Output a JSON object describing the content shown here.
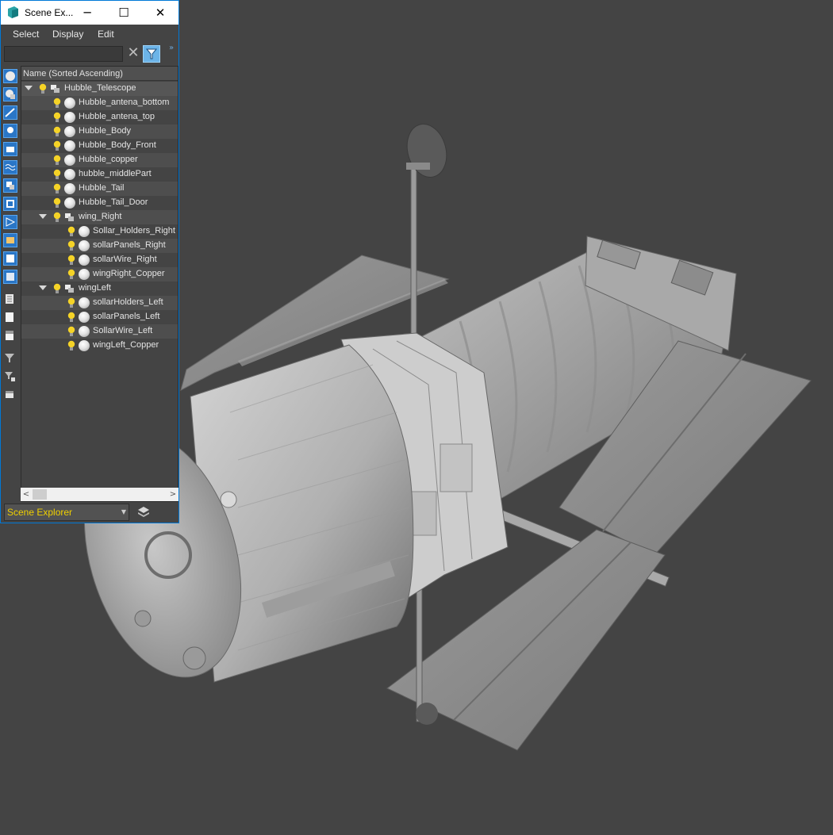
{
  "window": {
    "title": "Scene Ex...",
    "minimize_icon": "minimize-icon",
    "maximize_icon": "maximize-icon",
    "close_icon": "close-icon"
  },
  "menu": [
    "Select",
    "Display",
    "Edit"
  ],
  "search": {
    "value": "",
    "placeholder": ""
  },
  "toolbar_more": "»",
  "tree": {
    "header": "Name (Sorted Ascending)",
    "rows": [
      {
        "label": "Hubble_Telescope",
        "type": "group",
        "depth": 0,
        "expanded": true
      },
      {
        "label": "Hubble_antena_bottom",
        "type": "object",
        "depth": 1
      },
      {
        "label": "Hubble_antena_top",
        "type": "object",
        "depth": 1
      },
      {
        "label": "Hubble_Body",
        "type": "object",
        "depth": 1
      },
      {
        "label": "Hubble_Body_Front",
        "type": "object",
        "depth": 1
      },
      {
        "label": "Hubble_copper",
        "type": "object",
        "depth": 1
      },
      {
        "label": "hubble_middlePart",
        "type": "object",
        "depth": 1
      },
      {
        "label": "Hubble_Tail",
        "type": "object",
        "depth": 1
      },
      {
        "label": "Hubble_Tail_Door",
        "type": "object",
        "depth": 1
      },
      {
        "label": "wing_Right",
        "type": "group",
        "depth": 1,
        "expanded": true
      },
      {
        "label": "Sollar_Holders_Right",
        "type": "object",
        "depth": 2
      },
      {
        "label": "sollarPanels_Right",
        "type": "object",
        "depth": 2
      },
      {
        "label": "sollarWire_Right",
        "type": "object",
        "depth": 2
      },
      {
        "label": "wingRight_Copper",
        "type": "object",
        "depth": 2
      },
      {
        "label": "wingLeft",
        "type": "group",
        "depth": 1,
        "expanded": true
      },
      {
        "label": "sollarHolders_Left",
        "type": "object",
        "depth": 2
      },
      {
        "label": "sollarPanels_Left",
        "type": "object",
        "depth": 2
      },
      {
        "label": "SollarWire_Left",
        "type": "object",
        "depth": 2
      },
      {
        "label": "wingLeft_Copper",
        "type": "object",
        "depth": 2
      }
    ]
  },
  "bottom": {
    "explorer_select": "Scene Explorer"
  },
  "colors": {
    "viewport_bg": "#444444",
    "accent": "#0078d7",
    "select_text": "#f0d000",
    "bulb": "#f5d327",
    "model_grey": "#b8b8b8",
    "panel_grey": "#8f8f8f",
    "copper": "#8a6d3b"
  },
  "icons": {
    "filter": "filter-icon",
    "clear": "clear-icon",
    "layers": "layers-icon",
    "toolstrip": [
      "display-all-icon",
      "display-geometry-icon",
      "display-shapes-icon",
      "display-lights-icon",
      "display-cameras-icon",
      "display-helpers-icon",
      "display-spacewarps-icon",
      "display-groups-icon",
      "display-xrefs-icon",
      "display-bones-icon",
      "display-containers-icon",
      "display-frozen-icon",
      "display-hidden-icon",
      "select-all-icon",
      "select-none-icon",
      "select-invert-icon",
      "filter-toggle-icon",
      "filter-settings-icon",
      "find-icon"
    ]
  }
}
